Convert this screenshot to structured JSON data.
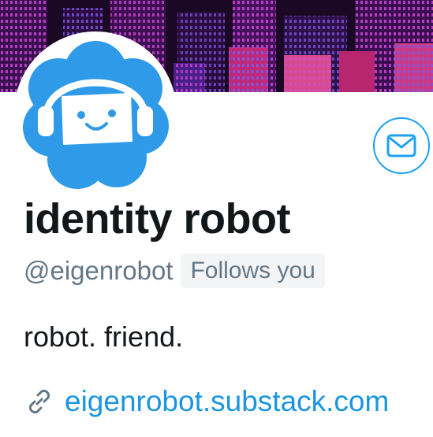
{
  "profile": {
    "display_name": "identity robot",
    "handle": "@eigenrobot",
    "follows_you_badge": "Follows you",
    "bio": "robot. friend.",
    "website": "eigenrobot.substack.com"
  },
  "icons": {
    "message": "envelope-icon",
    "link": "link-icon",
    "avatar": "robot-avatar"
  },
  "colors": {
    "accent": "#1da1f2",
    "link": "#1b95e0",
    "muted": "#657786",
    "text": "#14171a",
    "badge_bg": "#f2f4f6",
    "avatar_blue": "#2f9be8"
  }
}
